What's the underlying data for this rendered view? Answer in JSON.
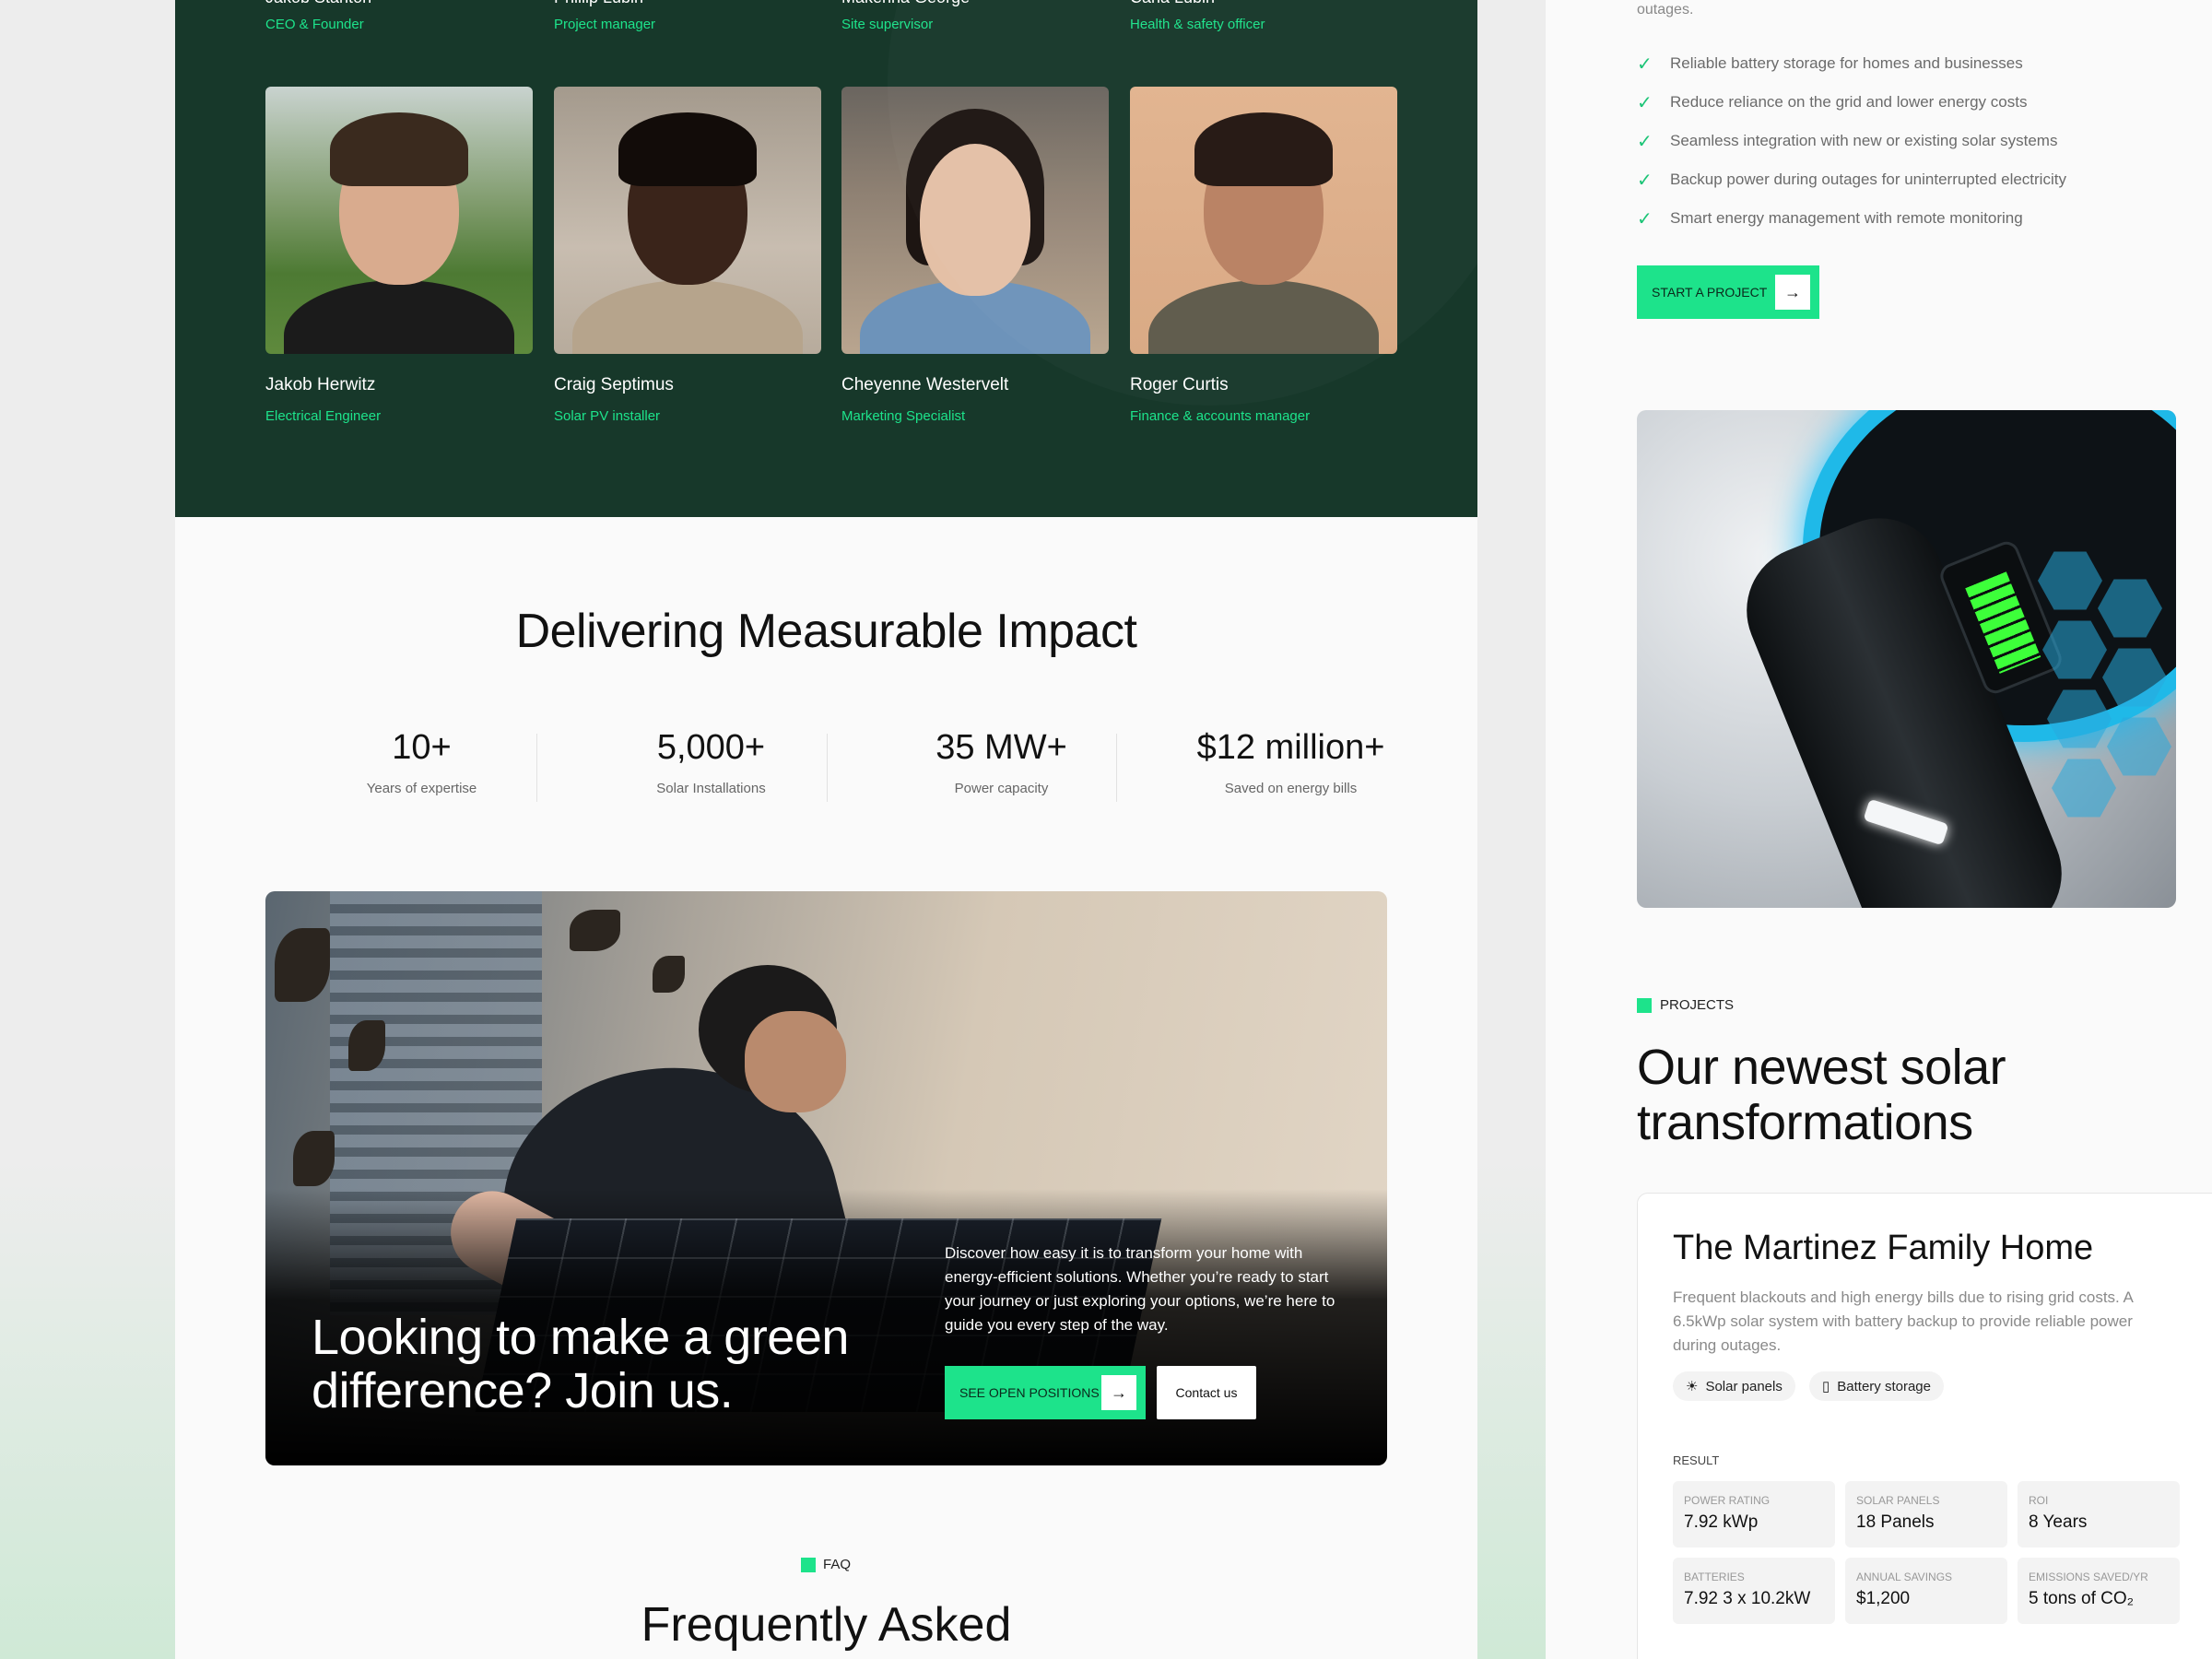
{
  "team": {
    "top_row": [
      {
        "name": "Jakob Stanton",
        "role": "CEO & Founder"
      },
      {
        "name": "Phillip Lubin",
        "role": "Project manager"
      },
      {
        "name": "Makenna George",
        "role": "Site supervisor"
      },
      {
        "name": "Carla Lubin",
        "role": "Health & safety officer"
      }
    ],
    "members": [
      {
        "name": "Jakob Herwitz",
        "role": "Electrical Engineer"
      },
      {
        "name": "Craig Septimus",
        "role": "Solar PV installer"
      },
      {
        "name": "Cheyenne Westervelt",
        "role": "Marketing Specialist"
      },
      {
        "name": "Roger Curtis",
        "role": "Finance & accounts manager"
      }
    ]
  },
  "impact": {
    "title": "Delivering Measurable Impact",
    "stats": [
      {
        "value": "10+",
        "label": "Years of expertise"
      },
      {
        "value": "5,000+",
        "label": "Solar Installations"
      },
      {
        "value": "35 MW+",
        "label": "Power capacity"
      },
      {
        "value": "$12 million+",
        "label": "Saved on energy bills"
      }
    ]
  },
  "join": {
    "title": "Looking to make a green difference? Join us.",
    "description": "Discover how easy it is to transform your home with energy-efficient solutions. Whether you’re ready to start your journey or just exploring your options, we’re here to guide you every step of the way.",
    "primary_button": "SEE OPEN POSITIONS",
    "secondary_button": "Contact us"
  },
  "faq": {
    "tag": "FAQ",
    "title": "Frequently Asked"
  },
  "sidebar": {
    "intro_tail": "outages.",
    "benefits": [
      "Reliable battery storage for homes and businesses",
      "Reduce reliance on the grid and lower energy costs",
      "Seamless integration with new or existing solar systems",
      "Backup power during outages for uninterrupted electricity",
      "Smart energy management with remote monitoring"
    ],
    "start_button": "START A PROJECT"
  },
  "projects": {
    "tag": "PROJECTS",
    "title": "Our newest solar transformations",
    "case": {
      "title": "The Martinez Family Home",
      "description": "Frequent blackouts and high energy bills due to rising grid costs. A 6.5kWp solar system with battery backup to provide reliable power during outages.",
      "tags": [
        "Solar panels",
        "Battery storage"
      ],
      "result_label": "RESULT",
      "metrics": [
        {
          "label": "POWER RATING",
          "value": "7.92 kWp"
        },
        {
          "label": "SOLAR PANELS",
          "value": "18 Panels"
        },
        {
          "label": "ROI",
          "value": "8 Years"
        },
        {
          "label": "BATTERIES",
          "value": "7.92 3 x 10.2kW"
        },
        {
          "label": "ANNUAL SAVINGS",
          "value": "$1,200"
        },
        {
          "label": "EMISSIONS SAVED/YR",
          "value": "5 tons of CO₂"
        }
      ]
    }
  },
  "icons": {
    "check": "check-icon",
    "arrow": "arrow-right-icon",
    "solar": "solar-panel-icon",
    "battery": "battery-icon"
  },
  "colors": {
    "accent": "#1de38b",
    "team_bg": "#17382a",
    "text_dark": "#111111"
  }
}
